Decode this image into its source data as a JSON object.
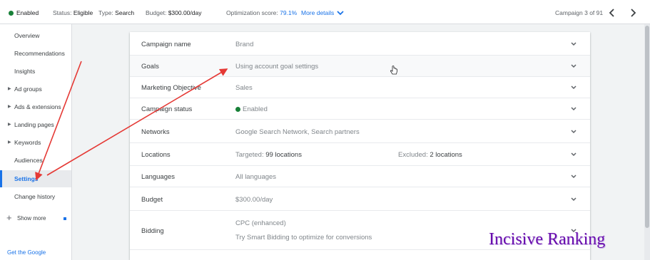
{
  "topbar": {
    "status_enabled": "Enabled",
    "status_label": "Status:",
    "status_value": "Eligible",
    "type_label": "Type:",
    "type_value": "Search",
    "budget_label": "Budget:",
    "budget_value": "$300.00/day",
    "opt_label": "Optimization score:",
    "opt_value": "79.1%",
    "more_details": "More details",
    "campaign_counter": "Campaign 3 of 91"
  },
  "sidebar": {
    "items": [
      {
        "label": "Overview"
      },
      {
        "label": "Recommendations"
      },
      {
        "label": "Insights"
      },
      {
        "label": "Ad groups"
      },
      {
        "label": "Ads & extensions"
      },
      {
        "label": "Landing pages"
      },
      {
        "label": "Keywords"
      },
      {
        "label": "Audiences"
      },
      {
        "label": "Settings"
      },
      {
        "label": "Change history"
      }
    ],
    "show_more": "Show more",
    "bottom_link": "Get the Google"
  },
  "settings": {
    "rows": [
      {
        "label": "Campaign name",
        "value": "Brand"
      },
      {
        "label": "Goals",
        "value": "Using account goal settings"
      },
      {
        "label": "Marketing Objective",
        "value": "Sales"
      },
      {
        "label": "Campaign status",
        "value": "Enabled"
      },
      {
        "label": "Networks",
        "value": "Google Search Network, Search partners"
      },
      {
        "label": "Locations",
        "targeted_label": "Targeted:",
        "targeted_value": "99 locations",
        "excluded_label": "Excluded:",
        "excluded_value": "2 locations"
      },
      {
        "label": "Languages",
        "value": "All languages"
      },
      {
        "label": "Budget",
        "value": "$300.00/day"
      },
      {
        "label": "Bidding",
        "value": "CPC (enhanced)",
        "link": "Try Smart Bidding to optimize for conversions"
      }
    ]
  },
  "watermark": "Incisive Ranking",
  "colors": {
    "accent": "#1a73e8",
    "status_green": "#188038",
    "annotation_red": "#e53935",
    "watermark": "#6a0dad"
  }
}
